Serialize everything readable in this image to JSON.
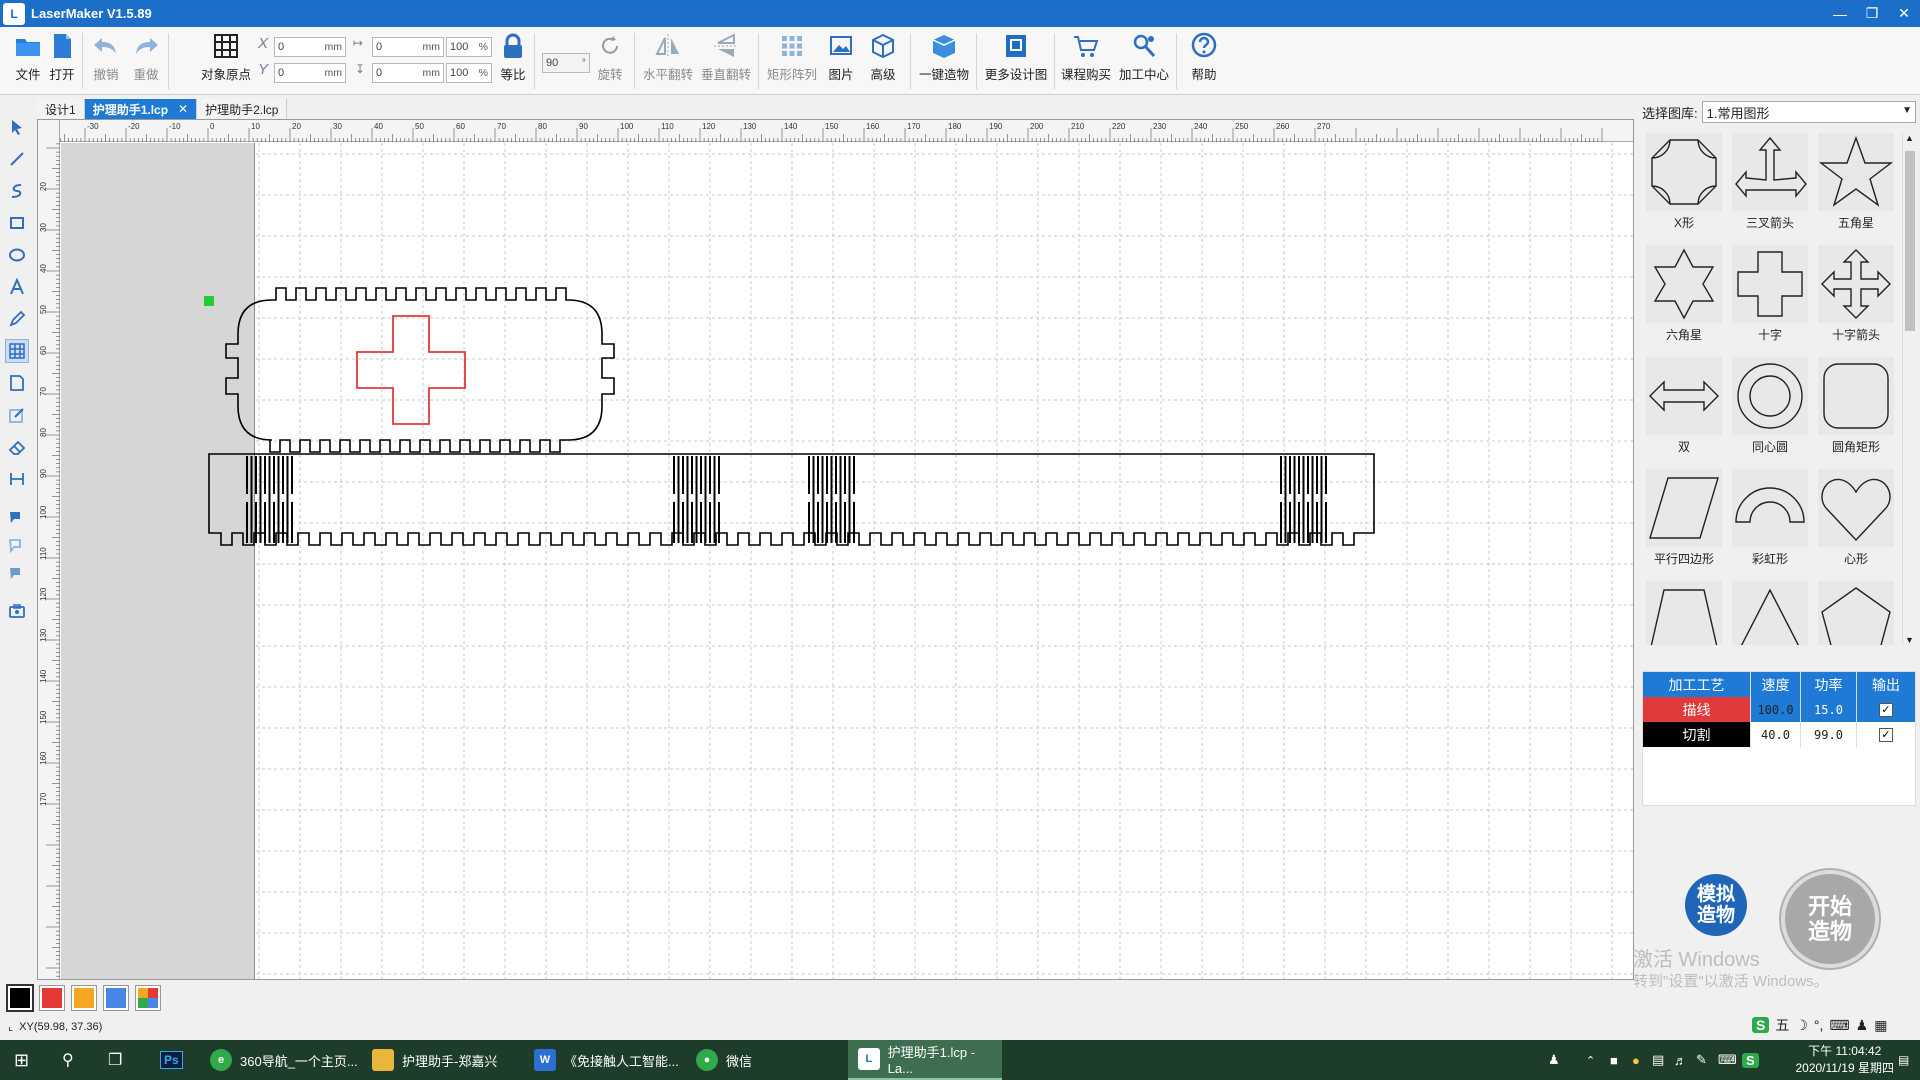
{
  "window": {
    "title": "LaserMaker V1.5.89",
    "icon_name": "lasermaker-app-icon",
    "controls": [
      "minimize-icon",
      "restore-icon",
      "close-icon"
    ]
  },
  "toolbar": {
    "file": "文件",
    "open": "打开",
    "undo": "撤销",
    "redo": "重做",
    "origin": "对象原点",
    "x_label": "X",
    "y_label": "Y",
    "x_value": "0",
    "y_value": "0",
    "w_value": "0",
    "h_value": "0",
    "unit_mm": "mm",
    "unit_pct": "%",
    "w_pct": "100",
    "h_pct": "100",
    "ratio": "等比",
    "angle": "90",
    "rotate": "旋转",
    "hflip": "水平翻转",
    "vflip": "垂直翻转",
    "array": "矩形阵列",
    "image": "图片",
    "advanced": "高级",
    "one_click": "一键造物",
    "more_designs": "更多设计图",
    "course": "课程购买",
    "center": "加工中心",
    "help": "帮助"
  },
  "tabs": [
    {
      "label": "设计1",
      "active": false
    },
    {
      "label": "护理助手1.lcp",
      "active": true,
      "closable": true
    },
    {
      "label": "护理助手2.lcp",
      "active": false
    }
  ],
  "ruler": {
    "top_ticks": [
      "-30",
      "-20",
      "-10",
      "0",
      "10",
      "20",
      "30",
      "40",
      "50",
      "60",
      "70",
      "80",
      "90",
      "100",
      "110",
      "120",
      "130",
      "140",
      "150",
      "160",
      "170",
      "180",
      "190",
      "200",
      "210",
      "220",
      "230",
      "240",
      "250",
      "260",
      "270"
    ],
    "left_ticks": [
      "10",
      "20",
      "30",
      "40",
      "50",
      "60",
      "70",
      "80",
      "90",
      "100",
      "110",
      "120",
      "130",
      "140",
      "150",
      "160",
      "170"
    ]
  },
  "library": {
    "label": "选择图库:",
    "selected": "1.常用图形",
    "shapes": [
      {
        "name": "X形",
        "icon": "x-shape-icon"
      },
      {
        "name": "三叉箭头",
        "icon": "trident-arrow-icon"
      },
      {
        "name": "五角星",
        "icon": "five-star-icon"
      },
      {
        "name": "六角星",
        "icon": "six-star-icon"
      },
      {
        "name": "十字",
        "icon": "cross-icon"
      },
      {
        "name": "十字箭头",
        "icon": "cross-arrow-icon"
      },
      {
        "name": "双",
        "icon": "double-arrow-icon"
      },
      {
        "name": "同心圆",
        "icon": "concentric-circle-icon"
      },
      {
        "name": "圆角矩形",
        "icon": "rounded-rect-icon"
      },
      {
        "name": "平行四边形",
        "icon": "parallelogram-icon"
      },
      {
        "name": "彩虹形",
        "icon": "rainbow-icon"
      },
      {
        "name": "心形",
        "icon": "heart-icon"
      },
      {
        "name": "",
        "icon": "trapezoid-icon"
      },
      {
        "name": "",
        "icon": "triangle-icon"
      },
      {
        "name": "",
        "icon": "pentagon-icon"
      }
    ]
  },
  "process": {
    "headers": [
      "加工工艺",
      "速度",
      "功率",
      "输出"
    ],
    "rows": [
      {
        "name": "描线",
        "speed": "100.0",
        "power": "15.0",
        "output": true,
        "color": "#e03a3a",
        "selected": true
      },
      {
        "name": "切割",
        "speed": "40.0",
        "power": "99.0",
        "output": true,
        "color": "#000000",
        "selected": false
      }
    ]
  },
  "actions": {
    "simulate": "模拟造物",
    "start": "开始造物"
  },
  "watermark": {
    "line1": "激活 Windows",
    "line2": "转到\"设置\"以激活 Windows。"
  },
  "colors": [
    "#000000",
    "#e53935",
    "#f5a623",
    "#4a86e8",
    "multi"
  ],
  "status": {
    "coords": "XY(59.98, 37.36)"
  },
  "ime": {
    "mode": "五"
  },
  "taskbar": {
    "items": [
      {
        "label": "360导航_一个主页...",
        "icon": "browser-360-icon"
      },
      {
        "label": "护理助手-郑嘉兴",
        "icon": "folder-icon"
      },
      {
        "label": "《免接触人工智能...",
        "icon": "word-icon"
      },
      {
        "label": "微信",
        "icon": "wechat-icon"
      },
      {
        "label": "护理助手1.lcp - La...",
        "icon": "lasermaker-task-icon",
        "active": true
      }
    ],
    "ps_label": "Ps",
    "time": "下午 11:04:42",
    "date": "2020/11/19 星期四"
  }
}
